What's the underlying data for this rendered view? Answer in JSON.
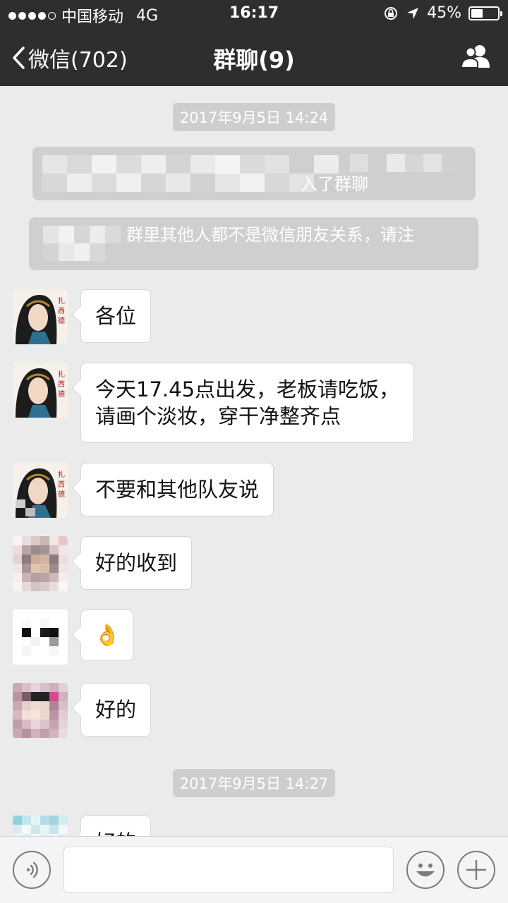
{
  "status_bar": {
    "carrier": "中国移动",
    "network": "4G",
    "time": "16:17",
    "battery": "45%",
    "battery_level": 0.45
  },
  "nav": {
    "back_label": "微信(702)",
    "title": "群聊(9)"
  },
  "chat": {
    "timestamps": [
      "2017年9月5日 14:24",
      "2017年9月5日 14:27"
    ],
    "system_messages": [
      "入了群聊",
      "群里其他人都不是微信朋友关系，请注"
    ],
    "messages": [
      {
        "text": "各位"
      },
      {
        "line1": "今天17.45点出发，老板请吃饭，",
        "line2": "请画个淡妆，穿干净整齐点"
      },
      {
        "text": "不要和其他队友说"
      },
      {
        "text": "好的收到"
      },
      {
        "emoji": "👌"
      },
      {
        "text": "好的"
      },
      {
        "text": "好的"
      }
    ]
  },
  "input_bar": {
    "voice_icon": "voice-icon",
    "emoji_icon": "emoji-icon",
    "plus_icon": "plus-icon"
  },
  "colors": {
    "header_bg": "#2e2e2e",
    "chat_bg": "#ebebeb",
    "bubble_bg": "#ffffff"
  }
}
